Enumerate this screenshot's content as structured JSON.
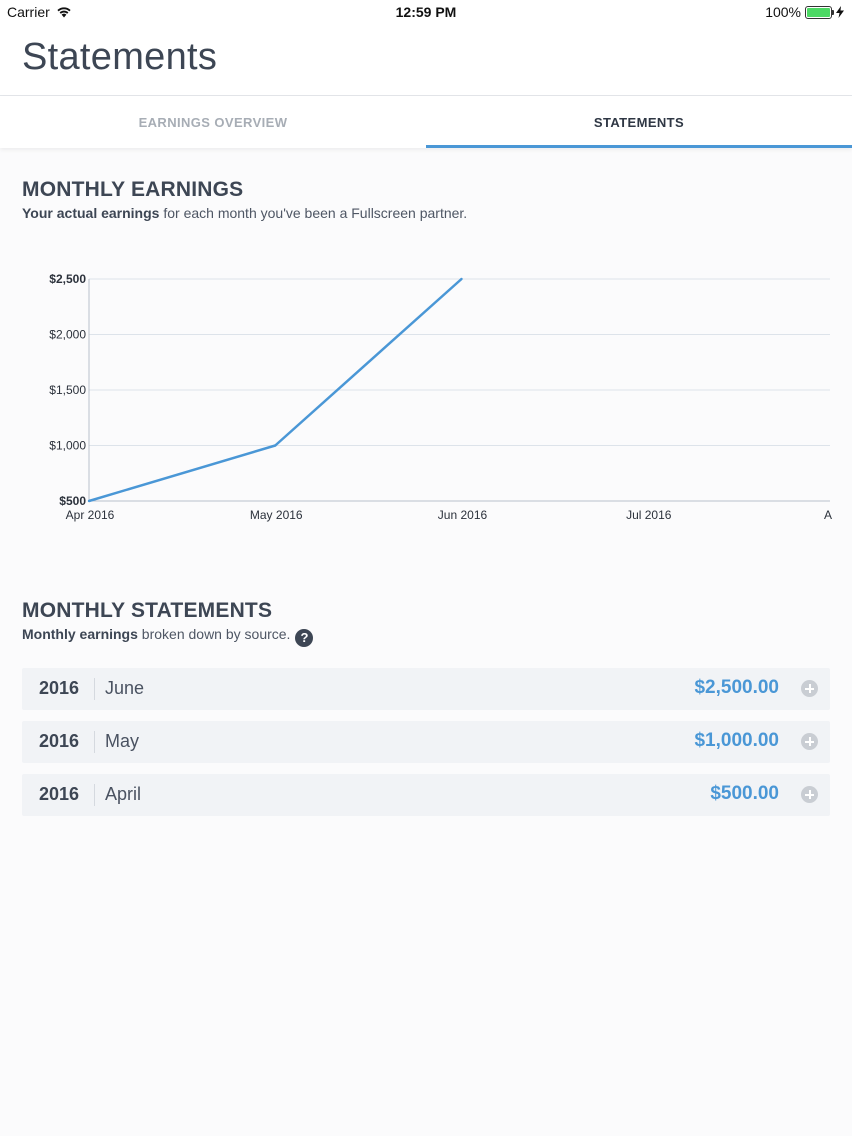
{
  "status_bar": {
    "carrier": "Carrier",
    "time": "12:59 PM",
    "battery": "100%",
    "icons": [
      "wifi-icon",
      "battery-icon",
      "charging-bolt-icon"
    ]
  },
  "header": {
    "title": "Statements"
  },
  "tabs": [
    {
      "label": "EARNINGS OVERVIEW",
      "active": false
    },
    {
      "label": "STATEMENTS",
      "active": true
    }
  ],
  "monthly_earnings": {
    "title": "MONTHLY EARNINGS",
    "subtitle_bold": "Your actual earnings",
    "subtitle_rest": " for each month you've been a Fullscreen partner."
  },
  "chart_data": {
    "type": "line",
    "x": [
      "Apr 2016",
      "May 2016",
      "Jun 2016",
      "Jul 2016",
      "A"
    ],
    "series": [
      {
        "values": [
          500,
          1000,
          2500,
          null,
          null
        ]
      }
    ],
    "ylim": [
      500,
      2500
    ],
    "yticks": [
      "$500",
      "$1,000",
      "$1,500",
      "$2,000",
      "$2,500"
    ],
    "grid": true,
    "colors": {
      "line": "#4a97d6",
      "grid": "#dde3ea",
      "axis": "#b9c1cb"
    }
  },
  "monthly_statements": {
    "title": "MONTHLY STATEMENTS",
    "subtitle_bold": "Monthly earnings",
    "subtitle_rest": " broken down by source.",
    "help_icon": "?",
    "rows": [
      {
        "year": "2016",
        "month": "June",
        "amount": "$2,500.00"
      },
      {
        "year": "2016",
        "month": "May",
        "amount": "$1,000.00"
      },
      {
        "year": "2016",
        "month": "April",
        "amount": "$500.00"
      }
    ]
  },
  "colors": {
    "accent": "#4a97d6",
    "text": "#3d4654",
    "muted_tab": "#a7adb5"
  }
}
